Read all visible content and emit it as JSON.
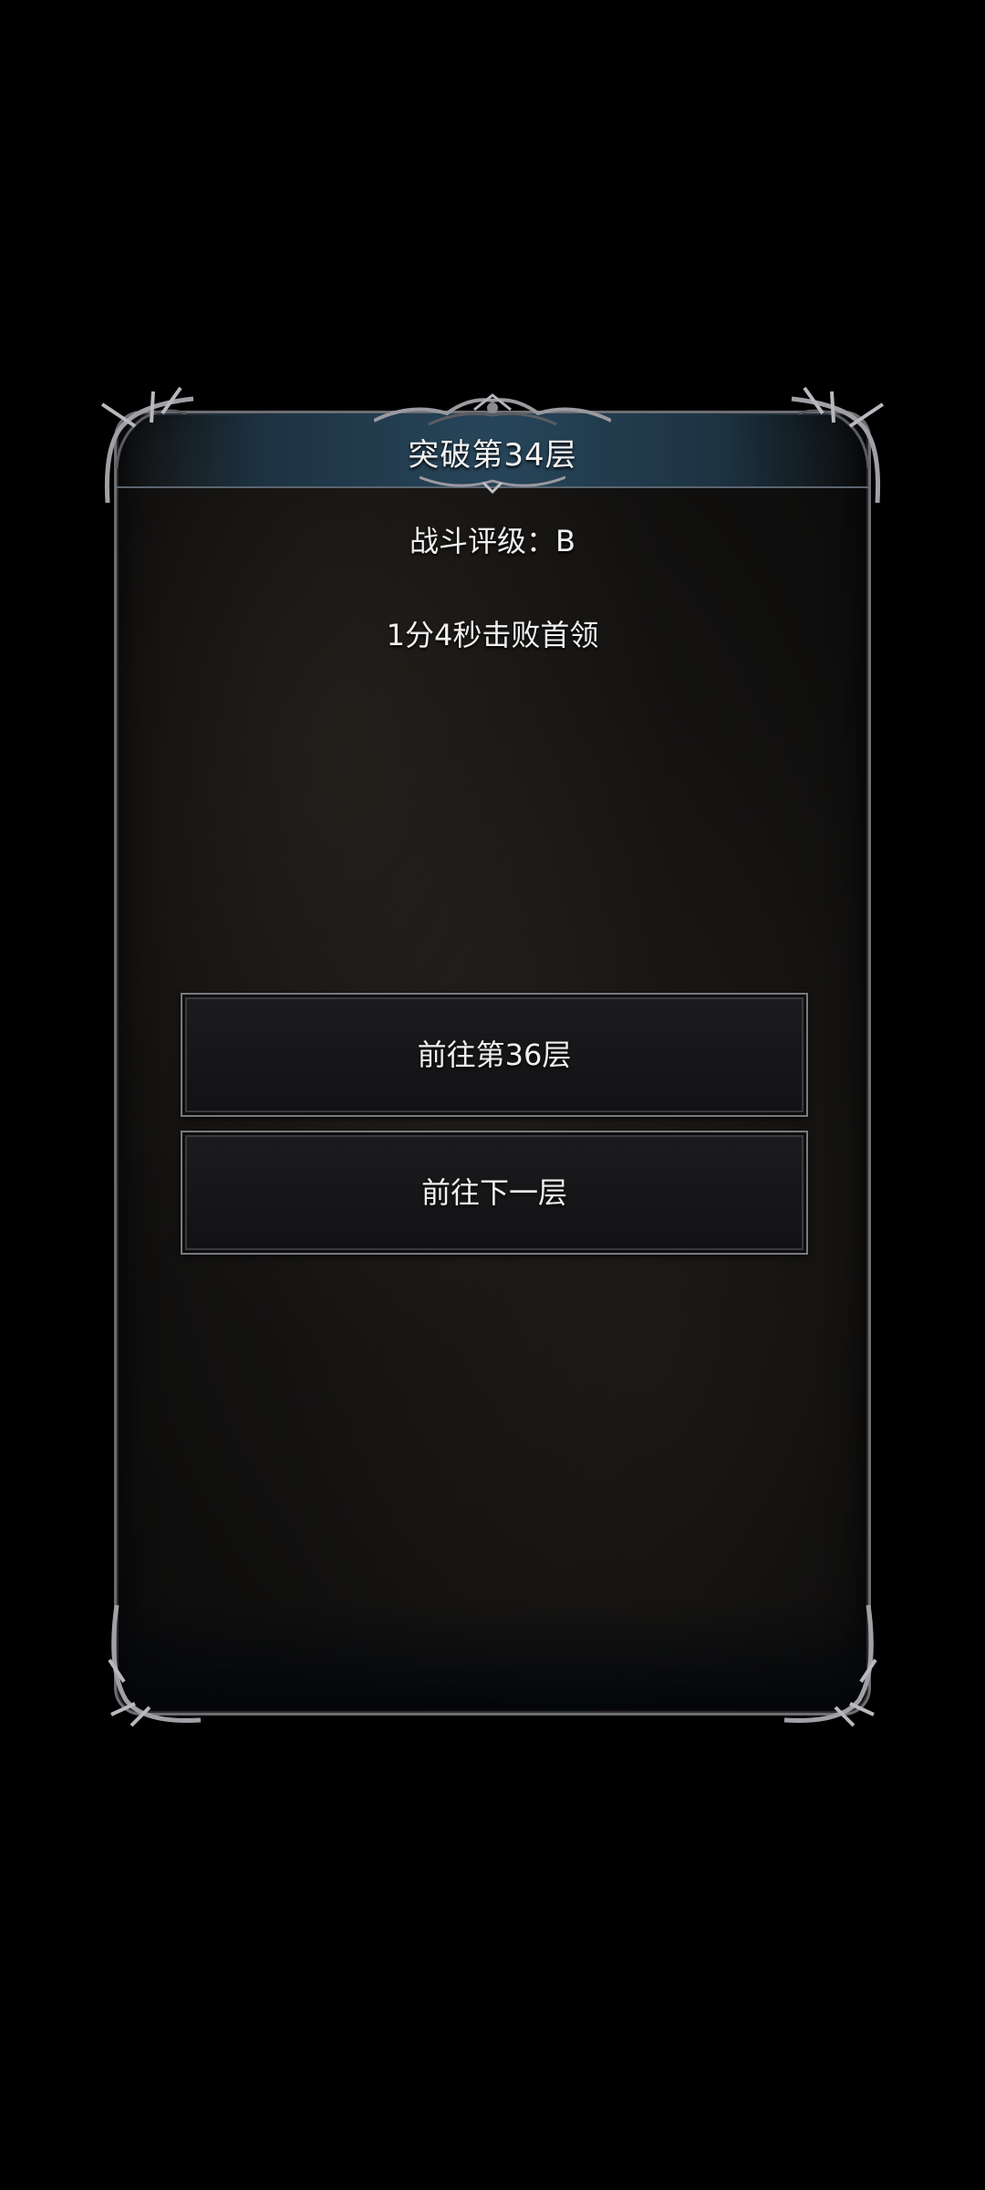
{
  "dialog": {
    "title": "突破第34层",
    "rating": "战斗评级：B",
    "result": "1分4秒击败首领"
  },
  "buttons": {
    "goto_floor": "前往第36层",
    "next_floor": "前往下一层"
  },
  "colors": {
    "background": "#000000",
    "panel": "#121110",
    "header": "#27455a",
    "frame": "#6e6e72",
    "text": "#f0f0f0"
  },
  "icons": [
    "ornament-top-icon",
    "ornament-corner-icon"
  ]
}
